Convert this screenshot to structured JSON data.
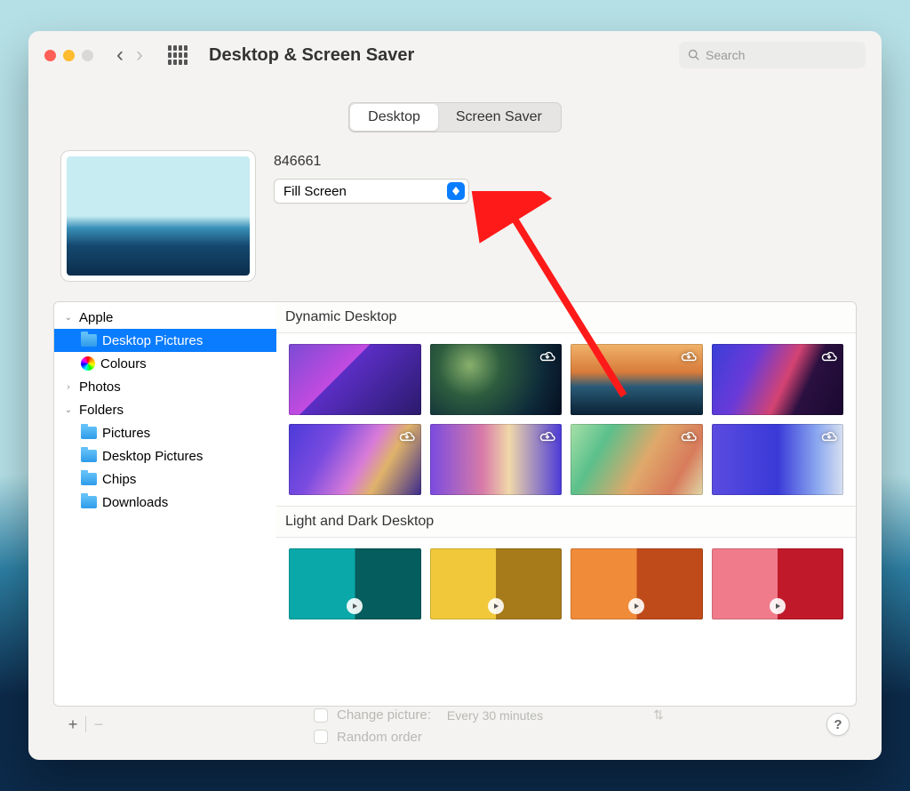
{
  "window": {
    "title": "Desktop & Screen Saver"
  },
  "search": {
    "placeholder": "Search"
  },
  "tabs": {
    "desktop": "Desktop",
    "screensaver": "Screen Saver",
    "active": "desktop"
  },
  "current": {
    "name": "846661",
    "fill_mode": "Fill Screen"
  },
  "sidebar": {
    "apple": {
      "label": "Apple",
      "expanded": true,
      "children": [
        {
          "label": "Desktop Pictures",
          "selected": true
        },
        {
          "label": "Colours"
        }
      ]
    },
    "photos": {
      "label": "Photos",
      "expanded": false
    },
    "folders": {
      "label": "Folders",
      "expanded": true,
      "children": [
        {
          "label": "Pictures"
        },
        {
          "label": "Desktop Pictures"
        },
        {
          "label": "Chips"
        },
        {
          "label": "Downloads"
        }
      ]
    }
  },
  "sections": {
    "dynamic": {
      "title": "Dynamic Desktop",
      "items": [
        {
          "cloud": false
        },
        {
          "cloud": true
        },
        {
          "cloud": true
        },
        {
          "cloud": true
        },
        {
          "cloud": true
        },
        {
          "cloud": true
        },
        {
          "cloud": true
        },
        {
          "cloud": true
        }
      ]
    },
    "lightdark": {
      "title": "Light and Dark Desktop",
      "items": [
        {
          "dyn": true
        },
        {
          "dyn": true
        },
        {
          "dyn": true
        },
        {
          "dyn": true
        }
      ]
    }
  },
  "footer": {
    "change_picture_label": "Change picture:",
    "interval": "Every 30 minutes",
    "random_label": "Random order",
    "help": "?"
  }
}
